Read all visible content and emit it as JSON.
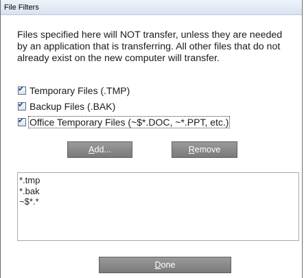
{
  "window": {
    "title": "File Filters"
  },
  "description": "Files specified here will NOT transfer, unless they are needed by an application that is transferring. All other files that do not already exist on the new computer will transfer.",
  "filters": [
    {
      "label": "Temporary Files (.TMP)",
      "checked": true
    },
    {
      "label": "Backup Files (.BAK)",
      "checked": true
    },
    {
      "label": "Office Temporary Files (~$*.DOC, ~*.PPT, etc.)",
      "checked": true
    }
  ],
  "buttons": {
    "add": {
      "mnemonic": "A",
      "rest": "dd..."
    },
    "remove": {
      "mnemonic": "R",
      "rest": "emove"
    },
    "done": {
      "mnemonic": "D",
      "rest": "one"
    }
  },
  "patterns": [
    "*.tmp",
    "*.bak",
    "~$*.*"
  ],
  "icons": {
    "check": "checkmark"
  },
  "colors": {
    "button_bg": "#8a8a8a",
    "check": "#1f3f88"
  }
}
